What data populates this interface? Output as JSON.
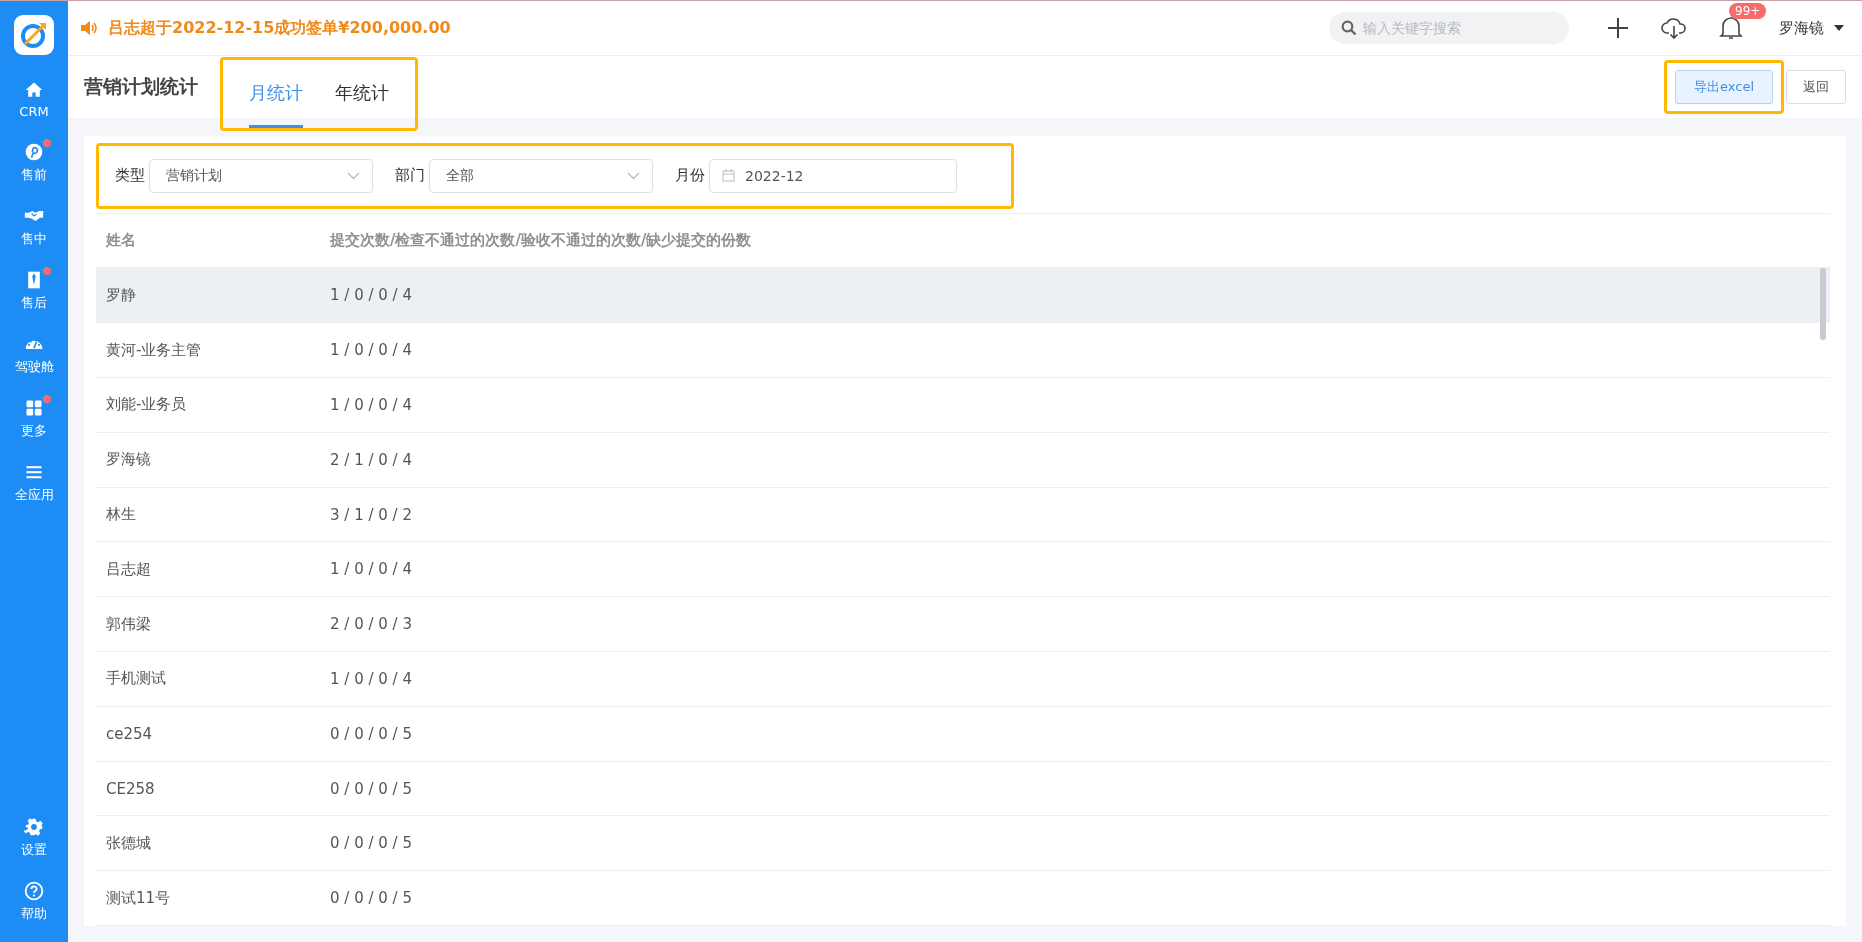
{
  "sidebar": {
    "items": [
      {
        "label": "CRM",
        "badge": false
      },
      {
        "label": "售前",
        "badge": true
      },
      {
        "label": "售中",
        "badge": false
      },
      {
        "label": "售后",
        "badge": true
      },
      {
        "label": "驾驶舱",
        "badge": false
      },
      {
        "label": "更多",
        "badge": true
      },
      {
        "label": "全应用",
        "badge": false
      }
    ],
    "bottom_items": [
      {
        "label": "设置"
      },
      {
        "label": "帮助"
      }
    ]
  },
  "header": {
    "announcement": "吕志超于2022-12-15成功签单¥200,000.00",
    "search": {
      "placeholder": "输入关键字搜索"
    },
    "notification_count": "99+",
    "user": "罗海镜"
  },
  "page": {
    "title": "营销计划统计",
    "tabs": [
      {
        "label": "月统计",
        "selected": true
      },
      {
        "label": "年统计",
        "selected": false
      }
    ],
    "buttons": [
      {
        "label": "导出excel",
        "kind": "primary"
      },
      {
        "label": "返回",
        "kind": "plain"
      }
    ]
  },
  "filters": [
    {
      "label": "类型",
      "value": "营销计划",
      "kind": "select"
    },
    {
      "label": "部门",
      "value": "全部",
      "kind": "select"
    },
    {
      "label": "月份",
      "value": "2022-12",
      "kind": "date"
    }
  ],
  "table": {
    "columns": [
      "姓名",
      "提交次数/检查不通过的次数/验收不通过的次数/缺少提交的份数"
    ],
    "rows": [
      {
        "cells": [
          "罗静",
          "1 / 0 / 0 / 4"
        ],
        "selected": true
      },
      {
        "cells": [
          "黄河-业务主管",
          "1 / 0 / 0 / 4"
        ],
        "selected": false
      },
      {
        "cells": [
          "刘能-业务员",
          "1 / 0 / 0 / 4"
        ],
        "selected": false
      },
      {
        "cells": [
          "罗海镜",
          "2 / 1 / 0 / 4"
        ],
        "selected": false
      },
      {
        "cells": [
          "林生",
          "3 / 1 / 0 / 2"
        ],
        "selected": false
      },
      {
        "cells": [
          "吕志超",
          "1 / 0 / 0 / 4"
        ],
        "selected": false
      },
      {
        "cells": [
          "郭伟梁",
          "2 / 0 / 0 / 3"
        ],
        "selected": false
      },
      {
        "cells": [
          "手机测试",
          "1 / 0 / 0 / 4"
        ],
        "selected": false
      },
      {
        "cells": [
          "ce254",
          "0 / 0 / 0 / 5"
        ],
        "selected": false
      },
      {
        "cells": [
          "CE258",
          "0 / 0 / 0 / 5"
        ],
        "selected": false
      },
      {
        "cells": [
          "张德城",
          "0 / 0 / 0 / 5"
        ],
        "selected": false
      },
      {
        "cells": [
          "测试11号",
          "0 / 0 / 0 / 5"
        ],
        "selected": false
      }
    ]
  }
}
